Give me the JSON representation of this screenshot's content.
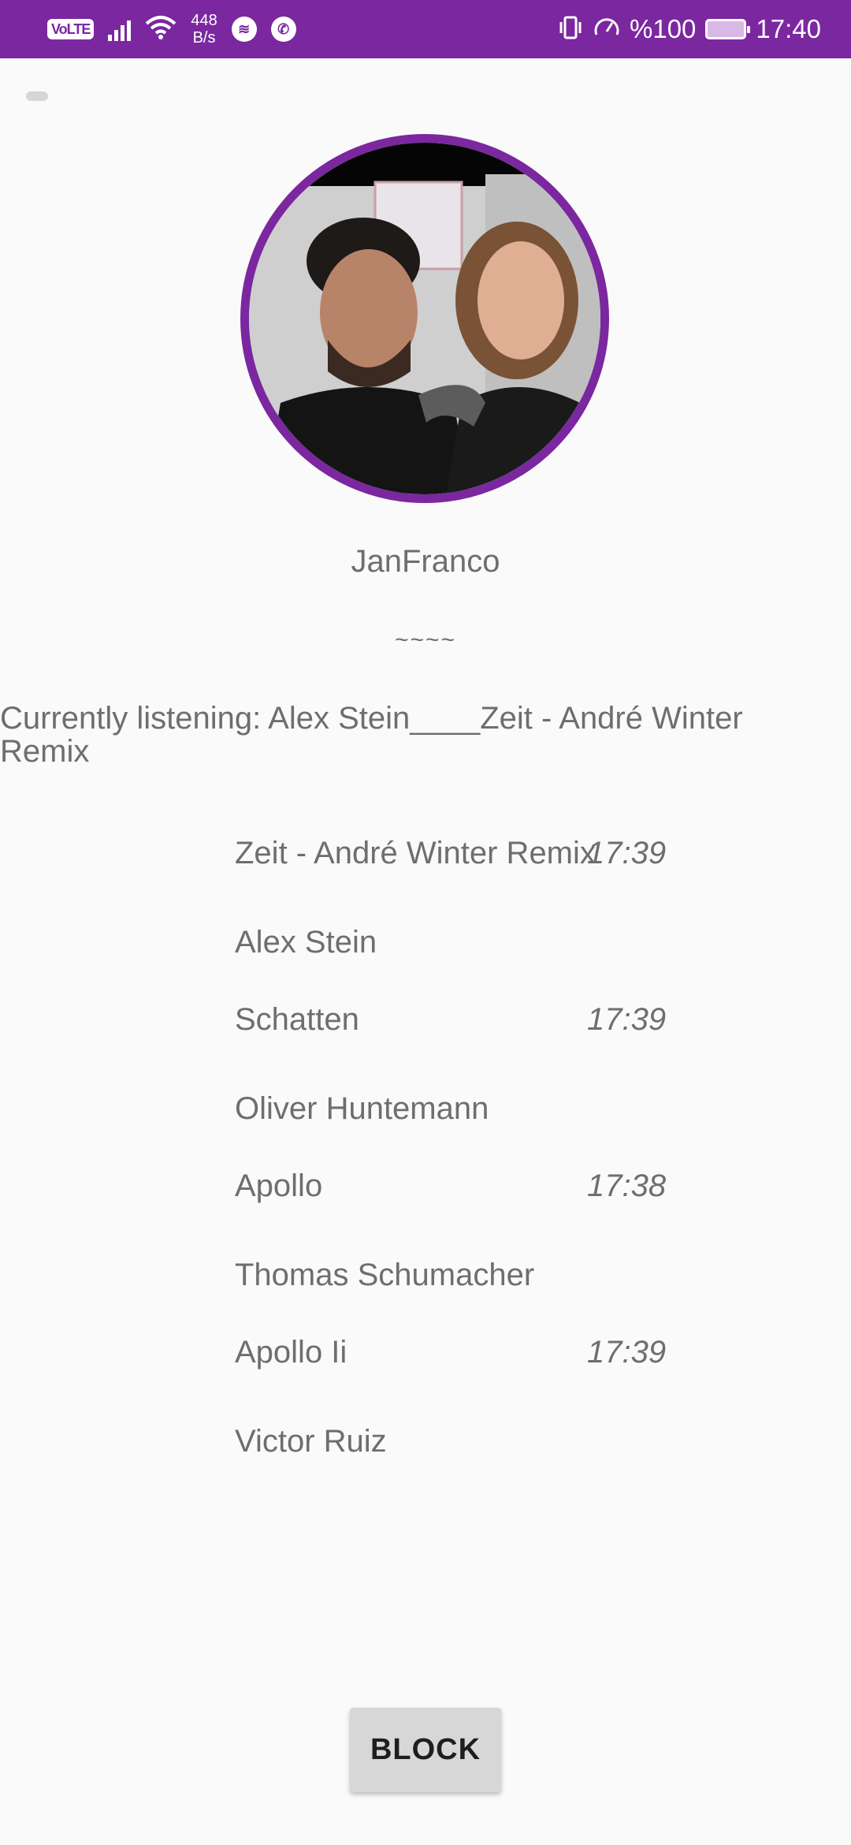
{
  "status_bar": {
    "volte": "VoLTE",
    "net_speed_value": "448",
    "net_speed_unit": "B/s",
    "battery": "%100",
    "time": "17:40",
    "icons": [
      "signal-icon",
      "wifi-icon",
      "spotify-icon",
      "whatsapp-icon",
      "vibrate-icon",
      "speed-icon",
      "battery-icon"
    ]
  },
  "profile": {
    "username": "JanFranco",
    "status_message": "~~~~",
    "currently_listening": "Currently listening: Alex Stein____Zeit - André Winter Remix"
  },
  "tracks": [
    {
      "title": "Zeit - André Winter Remix",
      "time": "17:39",
      "artist": "Alex Stein"
    },
    {
      "title": "Schatten",
      "time": "17:39",
      "artist": "Oliver Huntemann"
    },
    {
      "title": "Apollo",
      "time": "17:38",
      "artist": "Thomas Schumacher"
    },
    {
      "title": "Apollo Ii",
      "time": "17:39",
      "artist": "Victor Ruiz"
    }
  ],
  "actions": {
    "block_label": "BLOCK"
  },
  "colors": {
    "accent": "#7b27a0",
    "background": "#fafafa",
    "text": "#6e6e6e"
  }
}
